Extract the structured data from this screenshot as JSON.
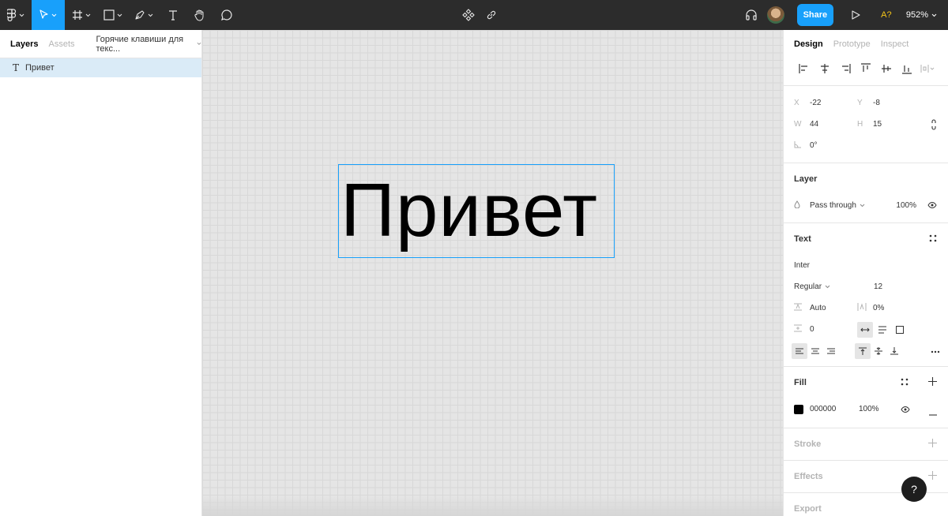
{
  "toolbar": {
    "share_label": "Share",
    "font_warning": "A?",
    "zoom": "952%"
  },
  "left_panel": {
    "tabs": [
      "Layers",
      "Assets"
    ],
    "page_name": "Горячие клавиши для текс...",
    "layers": [
      {
        "type": "T",
        "name": "Привет"
      }
    ]
  },
  "canvas": {
    "text": "Привет"
  },
  "right_panel": {
    "tabs": [
      "Design",
      "Prototype",
      "Inspect"
    ],
    "frame": {
      "x_label": "X",
      "x": "-22",
      "y_label": "Y",
      "y": "-8",
      "w_label": "W",
      "w": "44",
      "h_label": "H",
      "h": "15",
      "rotation": "0°"
    },
    "layer": {
      "title": "Layer",
      "blend": "Pass through",
      "opacity": "100%"
    },
    "text": {
      "title": "Text",
      "font_family": "Inter",
      "font_weight": "Regular",
      "font_size": "12",
      "line_height": "Auto",
      "letter_spacing": "0%",
      "paragraph_spacing": "0"
    },
    "fill": {
      "title": "Fill",
      "hex": "000000",
      "opacity": "100%"
    },
    "stroke": {
      "title": "Stroke"
    },
    "effects": {
      "title": "Effects"
    },
    "export": {
      "title": "Export"
    },
    "help": "?"
  }
}
